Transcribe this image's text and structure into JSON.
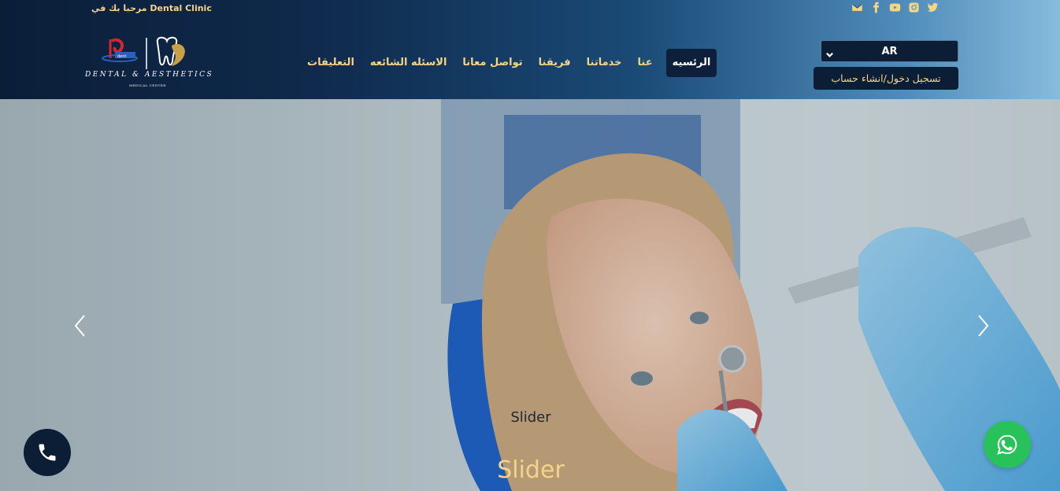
{
  "header": {
    "welcome_text": "مرحبا بك في Dental Clinic",
    "social_icons": [
      "envelope-icon",
      "facebook-icon",
      "youtube-icon",
      "instagram-icon",
      "twitter-icon"
    ],
    "logo": {
      "name": "DENTAL & AESTHETICS",
      "subtitle": "MEDICAL CENTER"
    },
    "nav": {
      "items": [
        {
          "label": "الرئسيه",
          "active": true
        },
        {
          "label": "عنا",
          "active": false
        },
        {
          "label": "خدماتنا",
          "active": false
        },
        {
          "label": "فريقنا",
          "active": false
        },
        {
          "label": "تواصل معانا",
          "active": false
        },
        {
          "label": "الاسئله الشائعه",
          "active": false
        },
        {
          "label": "التعليقات",
          "active": false
        }
      ]
    },
    "language": {
      "selected": "AR"
    },
    "login_label": "تسجيل دخول/انشاء حساب"
  },
  "hero": {
    "caption": "Slider",
    "title": "Slider",
    "prev_icon": "chevron-left-icon",
    "next_icon": "chevron-right-icon"
  },
  "floating": {
    "call_icon": "phone-icon",
    "whatsapp_icon": "whatsapp-icon"
  },
  "colors": {
    "header_dark": "#0b1e38",
    "header_light": "#86bcdc",
    "gold": "#f3d58a",
    "button_dark": "#0c1d36",
    "whatsapp_green": "#29c25a"
  }
}
